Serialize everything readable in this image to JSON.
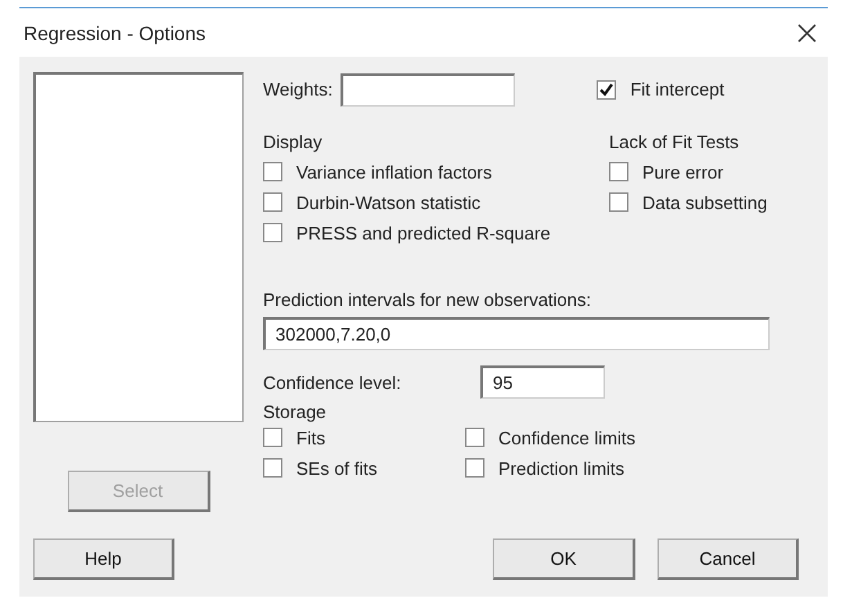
{
  "window": {
    "title": "Regression - Options"
  },
  "weights": {
    "label": "Weights:"
  },
  "fit_intercept": {
    "label": "Fit intercept",
    "checked": true
  },
  "display": {
    "heading": "Display",
    "options": [
      {
        "label": "Variance inflation factors",
        "checked": false
      },
      {
        "label": "Durbin-Watson statistic",
        "checked": false
      },
      {
        "label": "PRESS and predicted R-square",
        "checked": false
      }
    ]
  },
  "lack_of_fit": {
    "heading": "Lack of Fit Tests",
    "options": [
      {
        "label": "Pure error",
        "checked": false
      },
      {
        "label": "Data subsetting",
        "checked": false
      }
    ]
  },
  "prediction": {
    "label": "Prediction intervals for new observations:",
    "value": "302000,7.20,0"
  },
  "confidence": {
    "label": "Confidence level:",
    "value": "95"
  },
  "storage": {
    "heading": "Storage",
    "options": [
      {
        "label": "Fits",
        "checked": false
      },
      {
        "label": "Confidence limits",
        "checked": false
      },
      {
        "label": "SEs of fits",
        "checked": false
      },
      {
        "label": "Prediction limits",
        "checked": false
      }
    ]
  },
  "select_button": {
    "label": "Select",
    "disabled": true
  },
  "buttons": [
    {
      "label": "Help"
    },
    {
      "label": "OK"
    },
    {
      "label": "Cancel"
    }
  ]
}
